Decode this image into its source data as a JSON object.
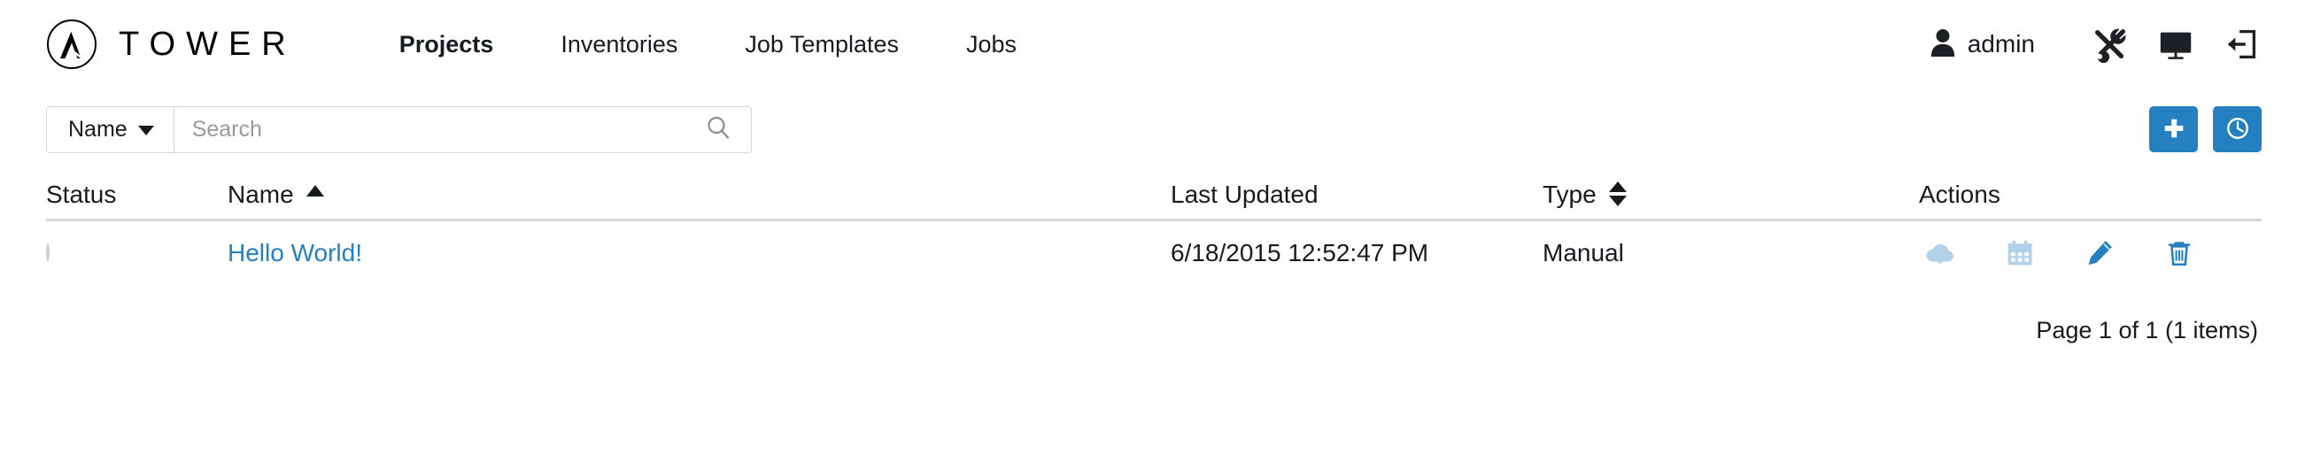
{
  "brand": {
    "name": "TOWER",
    "logo_icon": "ansible-a-logo-icon"
  },
  "nav": {
    "items": [
      {
        "label": "Projects",
        "active": true
      },
      {
        "label": "Inventories",
        "active": false
      },
      {
        "label": "Job Templates",
        "active": false
      },
      {
        "label": "Jobs",
        "active": false
      }
    ]
  },
  "user": {
    "name": "admin",
    "avatar_icon": "user-icon",
    "icons": [
      {
        "name": "settings-tools-icon",
        "title": "Settings"
      },
      {
        "name": "monitor-icon",
        "title": "Dashboard"
      },
      {
        "name": "logout-icon",
        "title": "Log out"
      }
    ]
  },
  "toolbar": {
    "search_field_label": "Name",
    "search_placeholder": "Search",
    "search_value": "",
    "search_icon": "search-icon",
    "add_button_label": "+",
    "add_button_icon": "plus-icon",
    "schedule_button_icon": "clock-icon",
    "accent_color": "#2580c2"
  },
  "table": {
    "columns": [
      {
        "key": "status",
        "label": "Status",
        "sort": "none"
      },
      {
        "key": "name",
        "label": "Name",
        "sort": "asc"
      },
      {
        "key": "updated",
        "label": "Last Updated",
        "sort": "none"
      },
      {
        "key": "type",
        "label": "Type",
        "sort": "both"
      },
      {
        "key": "actions",
        "label": "Actions",
        "sort": "none"
      }
    ],
    "rows": [
      {
        "status": "idle",
        "name": "Hello World!",
        "updated": "6/18/2015 12:52:47 PM",
        "type": "Manual",
        "actions": [
          {
            "name": "cloud-download-icon",
            "enabled": false
          },
          {
            "name": "calendar-schedule-icon",
            "enabled": false
          },
          {
            "name": "edit-pencil-icon",
            "enabled": true
          },
          {
            "name": "delete-trash-icon",
            "enabled": true
          }
        ]
      }
    ]
  },
  "footer": {
    "pagination": "Page 1 of 1 (1 items)"
  }
}
